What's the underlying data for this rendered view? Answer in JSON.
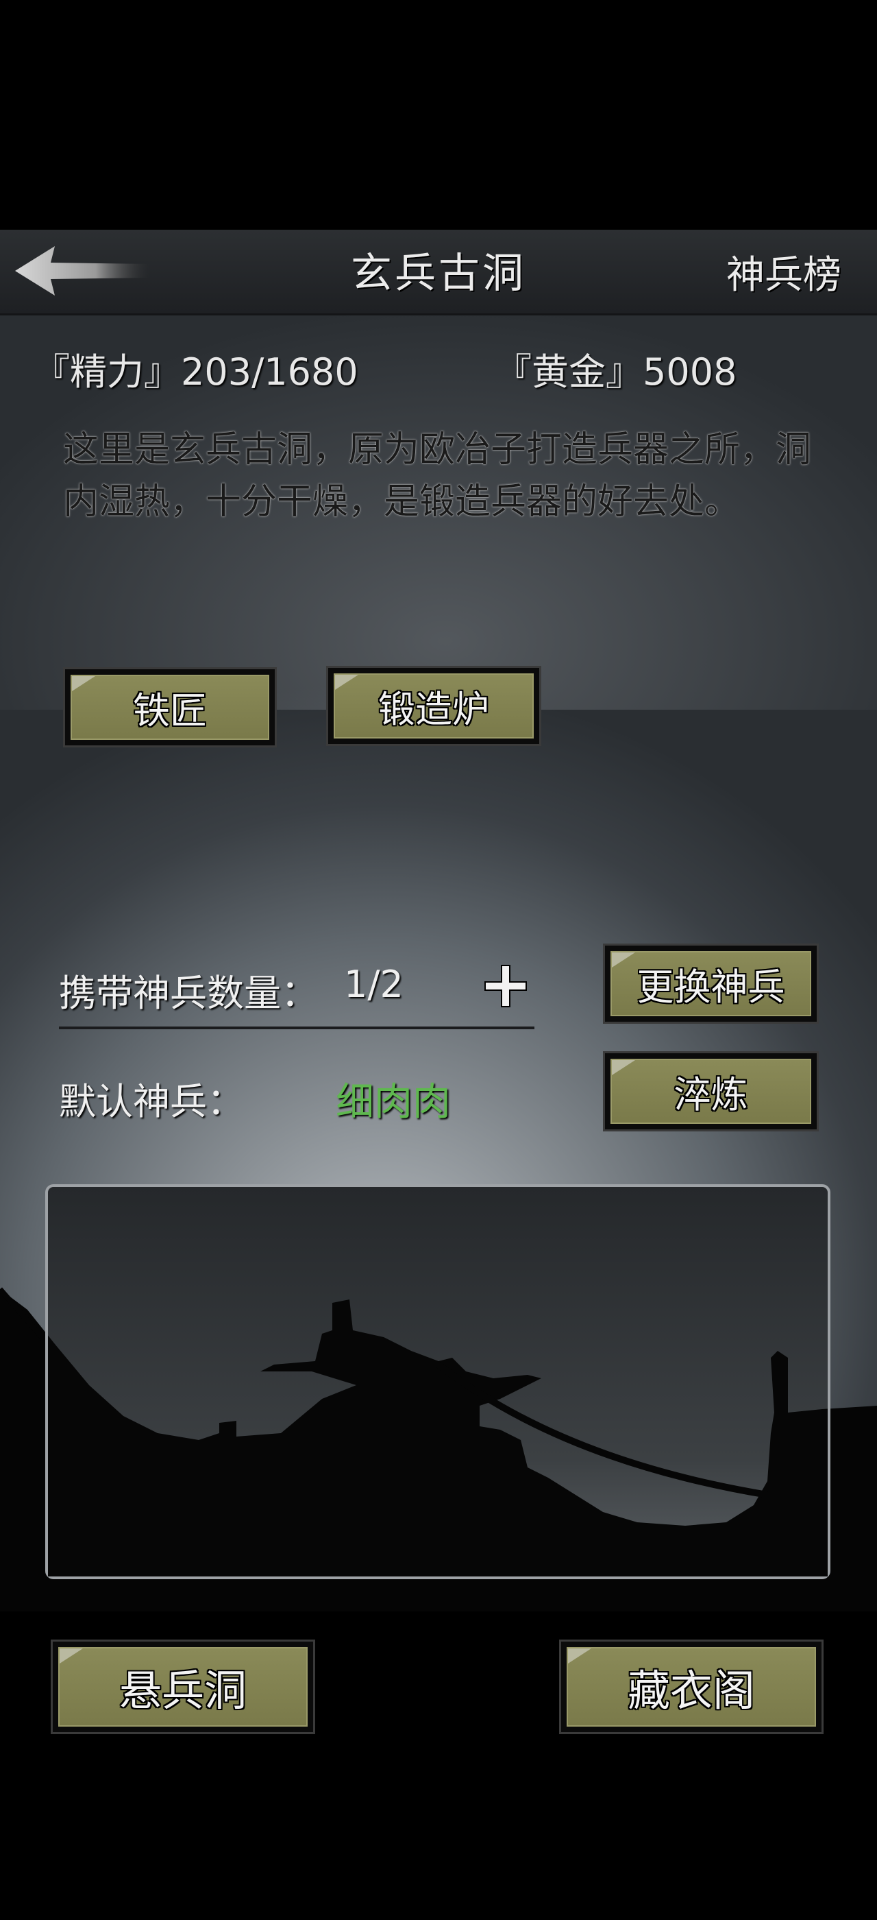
{
  "header": {
    "title": "玄兵古洞",
    "rank_link": "神兵榜"
  },
  "stats": {
    "energy": "『精力』203/1680",
    "gold": "『黄金』5008"
  },
  "description": "这里是玄兵古洞，原为欧冶子打造兵器之所，洞内湿热，十分干燥，是锻造兵器的好去处。",
  "actions": {
    "blacksmith": "铁匠",
    "forge": "锻造炉"
  },
  "weapons": {
    "carry_label": "携带神兵数量：",
    "carry_count": "1/2",
    "change_button": "更换神兵",
    "default_label": "默认神兵：",
    "default_weapon": "细肉肉",
    "temper_button": "淬炼"
  },
  "footer": {
    "hang_cave": "悬兵洞",
    "wardrobe": "藏衣阁"
  },
  "colors": {
    "button_face": "#7e7e4e",
    "weapon_name": "#5fb84f"
  }
}
